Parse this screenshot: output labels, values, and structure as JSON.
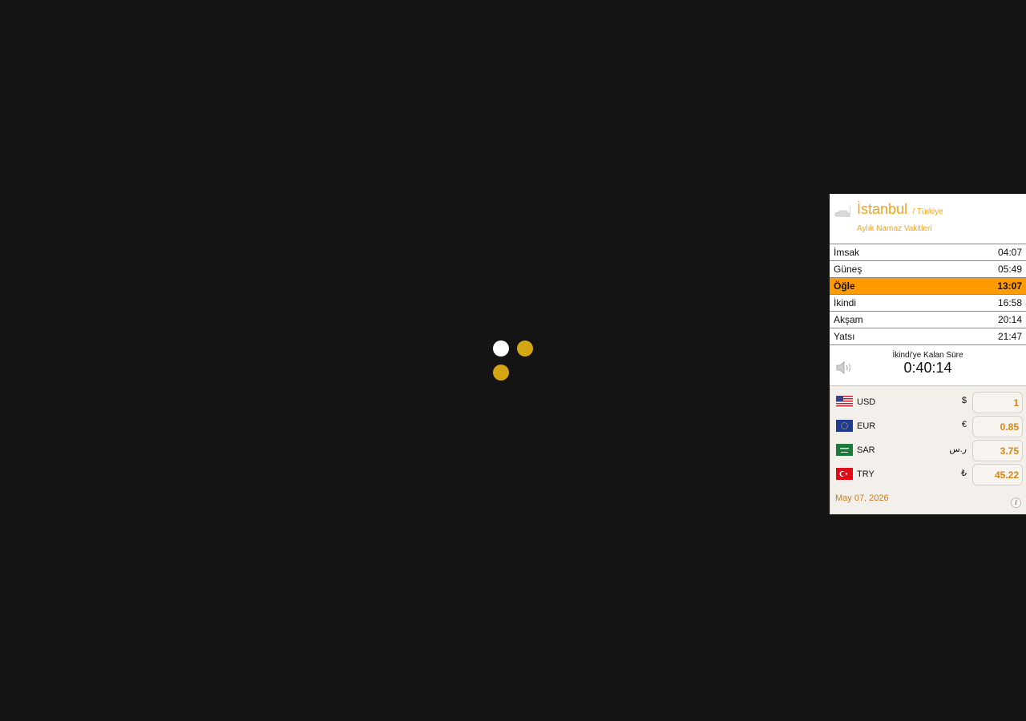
{
  "colors": {
    "page_bg": "#141414",
    "accent": "#f4a31a",
    "active_row": "#ff9a00",
    "dot_white": "#ffffff",
    "dot_gold": "#d4a614"
  },
  "loader": {
    "icon": "loading-dots"
  },
  "widget": {
    "city": "İstanbul",
    "country": "/ Türkiye",
    "monthly_link": "Aylık Namaz Vakitleri",
    "weather_icon": "cloud-icon",
    "prayers": [
      {
        "name": "İmsak",
        "time": "04:07"
      },
      {
        "name": "Güneş",
        "time": "05:49"
      },
      {
        "name": "Öğle",
        "time": "13:07"
      },
      {
        "name": "İkindi",
        "time": "16:58"
      },
      {
        "name": "Akşam",
        "time": "20:14"
      },
      {
        "name": "Yatsı",
        "time": "21:47"
      }
    ],
    "active_prayer_index": 2,
    "countdown": {
      "label": "İkindi'ye Kalan Süre",
      "value": "0:40:14",
      "icon": "speaker-icon"
    }
  },
  "currency": {
    "rows": [
      {
        "code": "USD",
        "symbol": "$",
        "value": "1",
        "flag": "us-flag-icon"
      },
      {
        "code": "EUR",
        "symbol": "€",
        "value": "0.85",
        "flag": "eu-flag-icon"
      },
      {
        "code": "SAR",
        "symbol": "ر.س",
        "value": "3.75",
        "flag": "sa-flag-icon"
      },
      {
        "code": "TRY",
        "symbol": "₺",
        "value": "45.22",
        "flag": "tr-flag-icon"
      }
    ],
    "date": "May 07, 2026",
    "info_label": "i"
  }
}
